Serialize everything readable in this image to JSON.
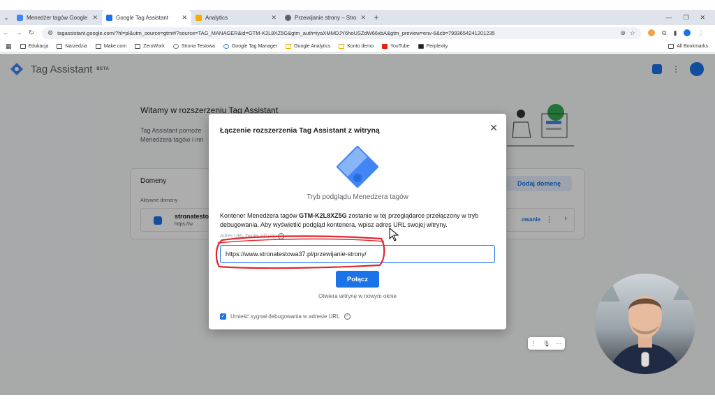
{
  "browser": {
    "tabs": [
      {
        "label": "Menedżer tagów Google",
        "fav": "#4285f4"
      },
      {
        "label": "Google Tag Assistant",
        "fav": "#1a73e8"
      },
      {
        "label": "Analytics",
        "fav": "#f9ab00"
      },
      {
        "label": "Przewijanie strony – Strona Tes",
        "fav": "#5f6368"
      }
    ],
    "url": "tagassistant.google.com/?hl=pl&utm_source=gtm#/?source=TAG_MANAGER&id=GTM-K2L8XZ5G&gtm_auth=iyaXMMDJY6hoUSZdW66xbA&gtm_preview=env-6&cb=7993654241201235",
    "bookmarks": [
      "Edukacja",
      "Narzedzia",
      "Make.com",
      "ZeroWork",
      "Strona Testowa",
      "Google Tag Manager",
      "Google Analytics",
      "Konto demo",
      "YouTube",
      "Perplexity"
    ],
    "all_bookmarks": "All Bookmarks"
  },
  "app": {
    "title": "Tag Assistant",
    "beta": "BETA",
    "welcome": "Witamy w rozszerzeniu Tag Assistant",
    "desc_line1": "Tag Assistant pomoże",
    "desc_line2": "Menedżera tagów i inn",
    "domains_title": "Domeny",
    "add_domain": "Dodaj domenę",
    "active_domains": "Aktywne domeny",
    "domain_name": "stronatesto",
    "domain_sub": "https://w",
    "domain_link": "owanie"
  },
  "modal": {
    "title": "Łączenie rozszerzenia Tag Assistant z witryną",
    "preview_label": "Tryb podglądu Menedżera tagów",
    "desc_before": "Kontener Menedżera tagów ",
    "container_id": "GTM-K2L8XZ5G",
    "desc_after": " zostanie w tej przeglądarce przełączony w tryb debugowania. Aby wyświetlić podgląd kontenera, wpisz adres URL swojej witryny.",
    "url_label": "Adres URL Twojej witryny",
    "url_value": "https://www.stronatestowa37.pl/przewijanie-strony/",
    "connect": "Połącz",
    "open_new_window": "Otwiera witrynę w nowym oknie",
    "debug_checkbox": "Umieść sygnał debugowania w adresie URL"
  },
  "colors": {
    "accent": "#1a73e8",
    "annotation": "#e3262b"
  }
}
